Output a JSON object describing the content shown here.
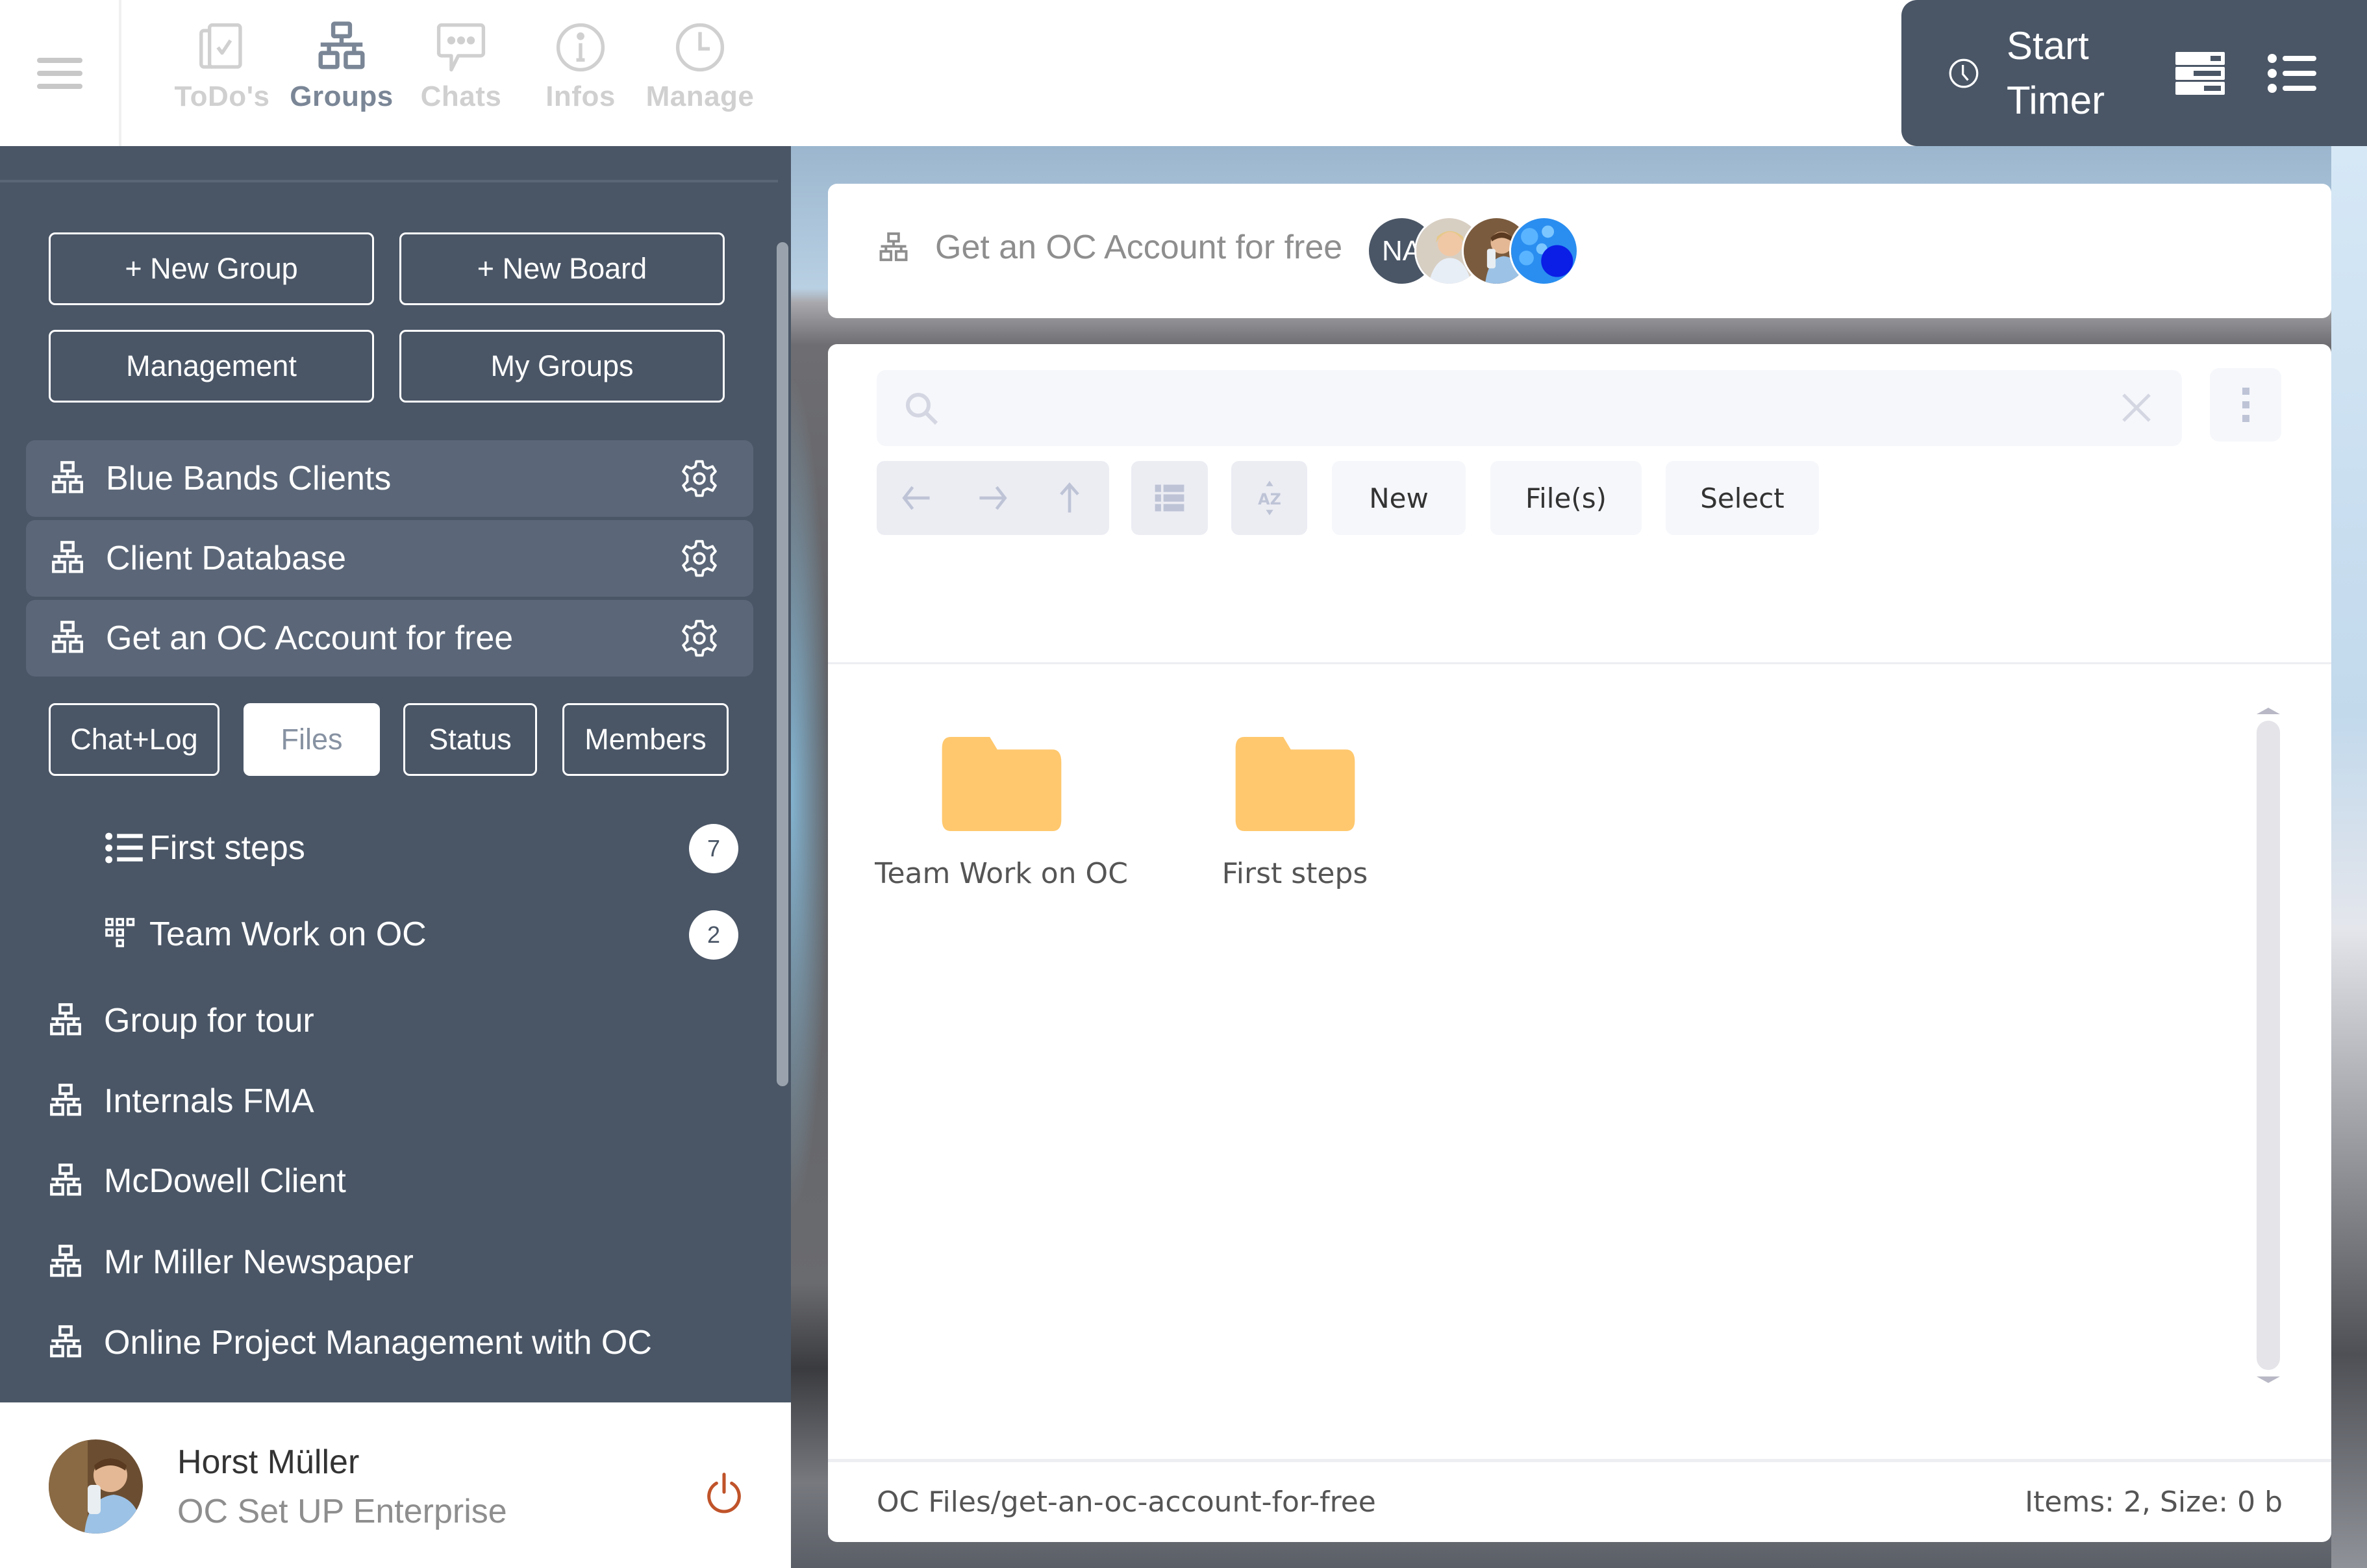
{
  "topbar": {
    "menu_icon": "hamburger-icon",
    "nav": [
      {
        "label": "ToDo's",
        "icon": "todo-checklist-icon",
        "active": false
      },
      {
        "label": "Groups",
        "icon": "network-groups-icon",
        "active": true
      },
      {
        "label": "Chats",
        "icon": "chat-bubble-icon",
        "active": false
      },
      {
        "label": "Infos",
        "icon": "info-circle-icon",
        "active": false
      },
      {
        "label": "Manage",
        "icon": "clock-icon",
        "active": false
      }
    ],
    "timer_label": "Start Timer",
    "timer_icon": "clock-icon",
    "view_icons": [
      "server-stack-icon",
      "bulleted-list-icon"
    ]
  },
  "sidebar": {
    "actions": {
      "new_group": "+ New Group",
      "new_board": "+ New Board",
      "management": "Management",
      "my_groups": "My Groups"
    },
    "pinned_groups": [
      {
        "name": "Blue Bands Clients"
      },
      {
        "name": "Client Database"
      },
      {
        "name": "Get an OC Account for free"
      }
    ],
    "tabs": [
      {
        "label": "Chat+Log",
        "active": false
      },
      {
        "label": "Files",
        "active": true
      },
      {
        "label": "Status",
        "active": false
      },
      {
        "label": "Members",
        "active": false
      }
    ],
    "boards": [
      {
        "name": "First steps",
        "icon": "list-icon",
        "count": "7"
      },
      {
        "name": "Team Work on OC",
        "icon": "board-grid-icon",
        "count": "2"
      }
    ],
    "groups": [
      {
        "name": "Group for tour"
      },
      {
        "name": "Internals FMA"
      },
      {
        "name": "McDowell Client"
      },
      {
        "name": "Mr Miller Newspaper"
      },
      {
        "name": "Online Project Management with OC"
      }
    ]
  },
  "user": {
    "name": "Horst Müller",
    "role": "OC Set UP Enterprise"
  },
  "group_header": {
    "title": "Get an OC Account for free",
    "members": [
      {
        "initials": "NA",
        "type": "initials"
      },
      {
        "type": "photo",
        "desc": "woman-photo"
      },
      {
        "type": "photo",
        "desc": "man-photo"
      },
      {
        "type": "photo",
        "desc": "blue-bubbles-image"
      }
    ]
  },
  "files": {
    "search_value": "",
    "toolbar": {
      "new": "New",
      "files": "File(s)",
      "select": "Select"
    },
    "items": [
      {
        "name": "Team Work on OC",
        "type": "folder"
      },
      {
        "name": "First steps",
        "type": "folder"
      }
    ],
    "path": "OC Files/get-an-oc-account-for-free",
    "stats": "Items: 2, Size: 0 b"
  },
  "colors": {
    "sidebar_bg": "#4a5666",
    "row_bg": "#5b6778",
    "folder": "#ffc86e",
    "power": "#c0532a",
    "nav_active": "#7a8696",
    "nav_inactive": "#d0d0d0"
  }
}
